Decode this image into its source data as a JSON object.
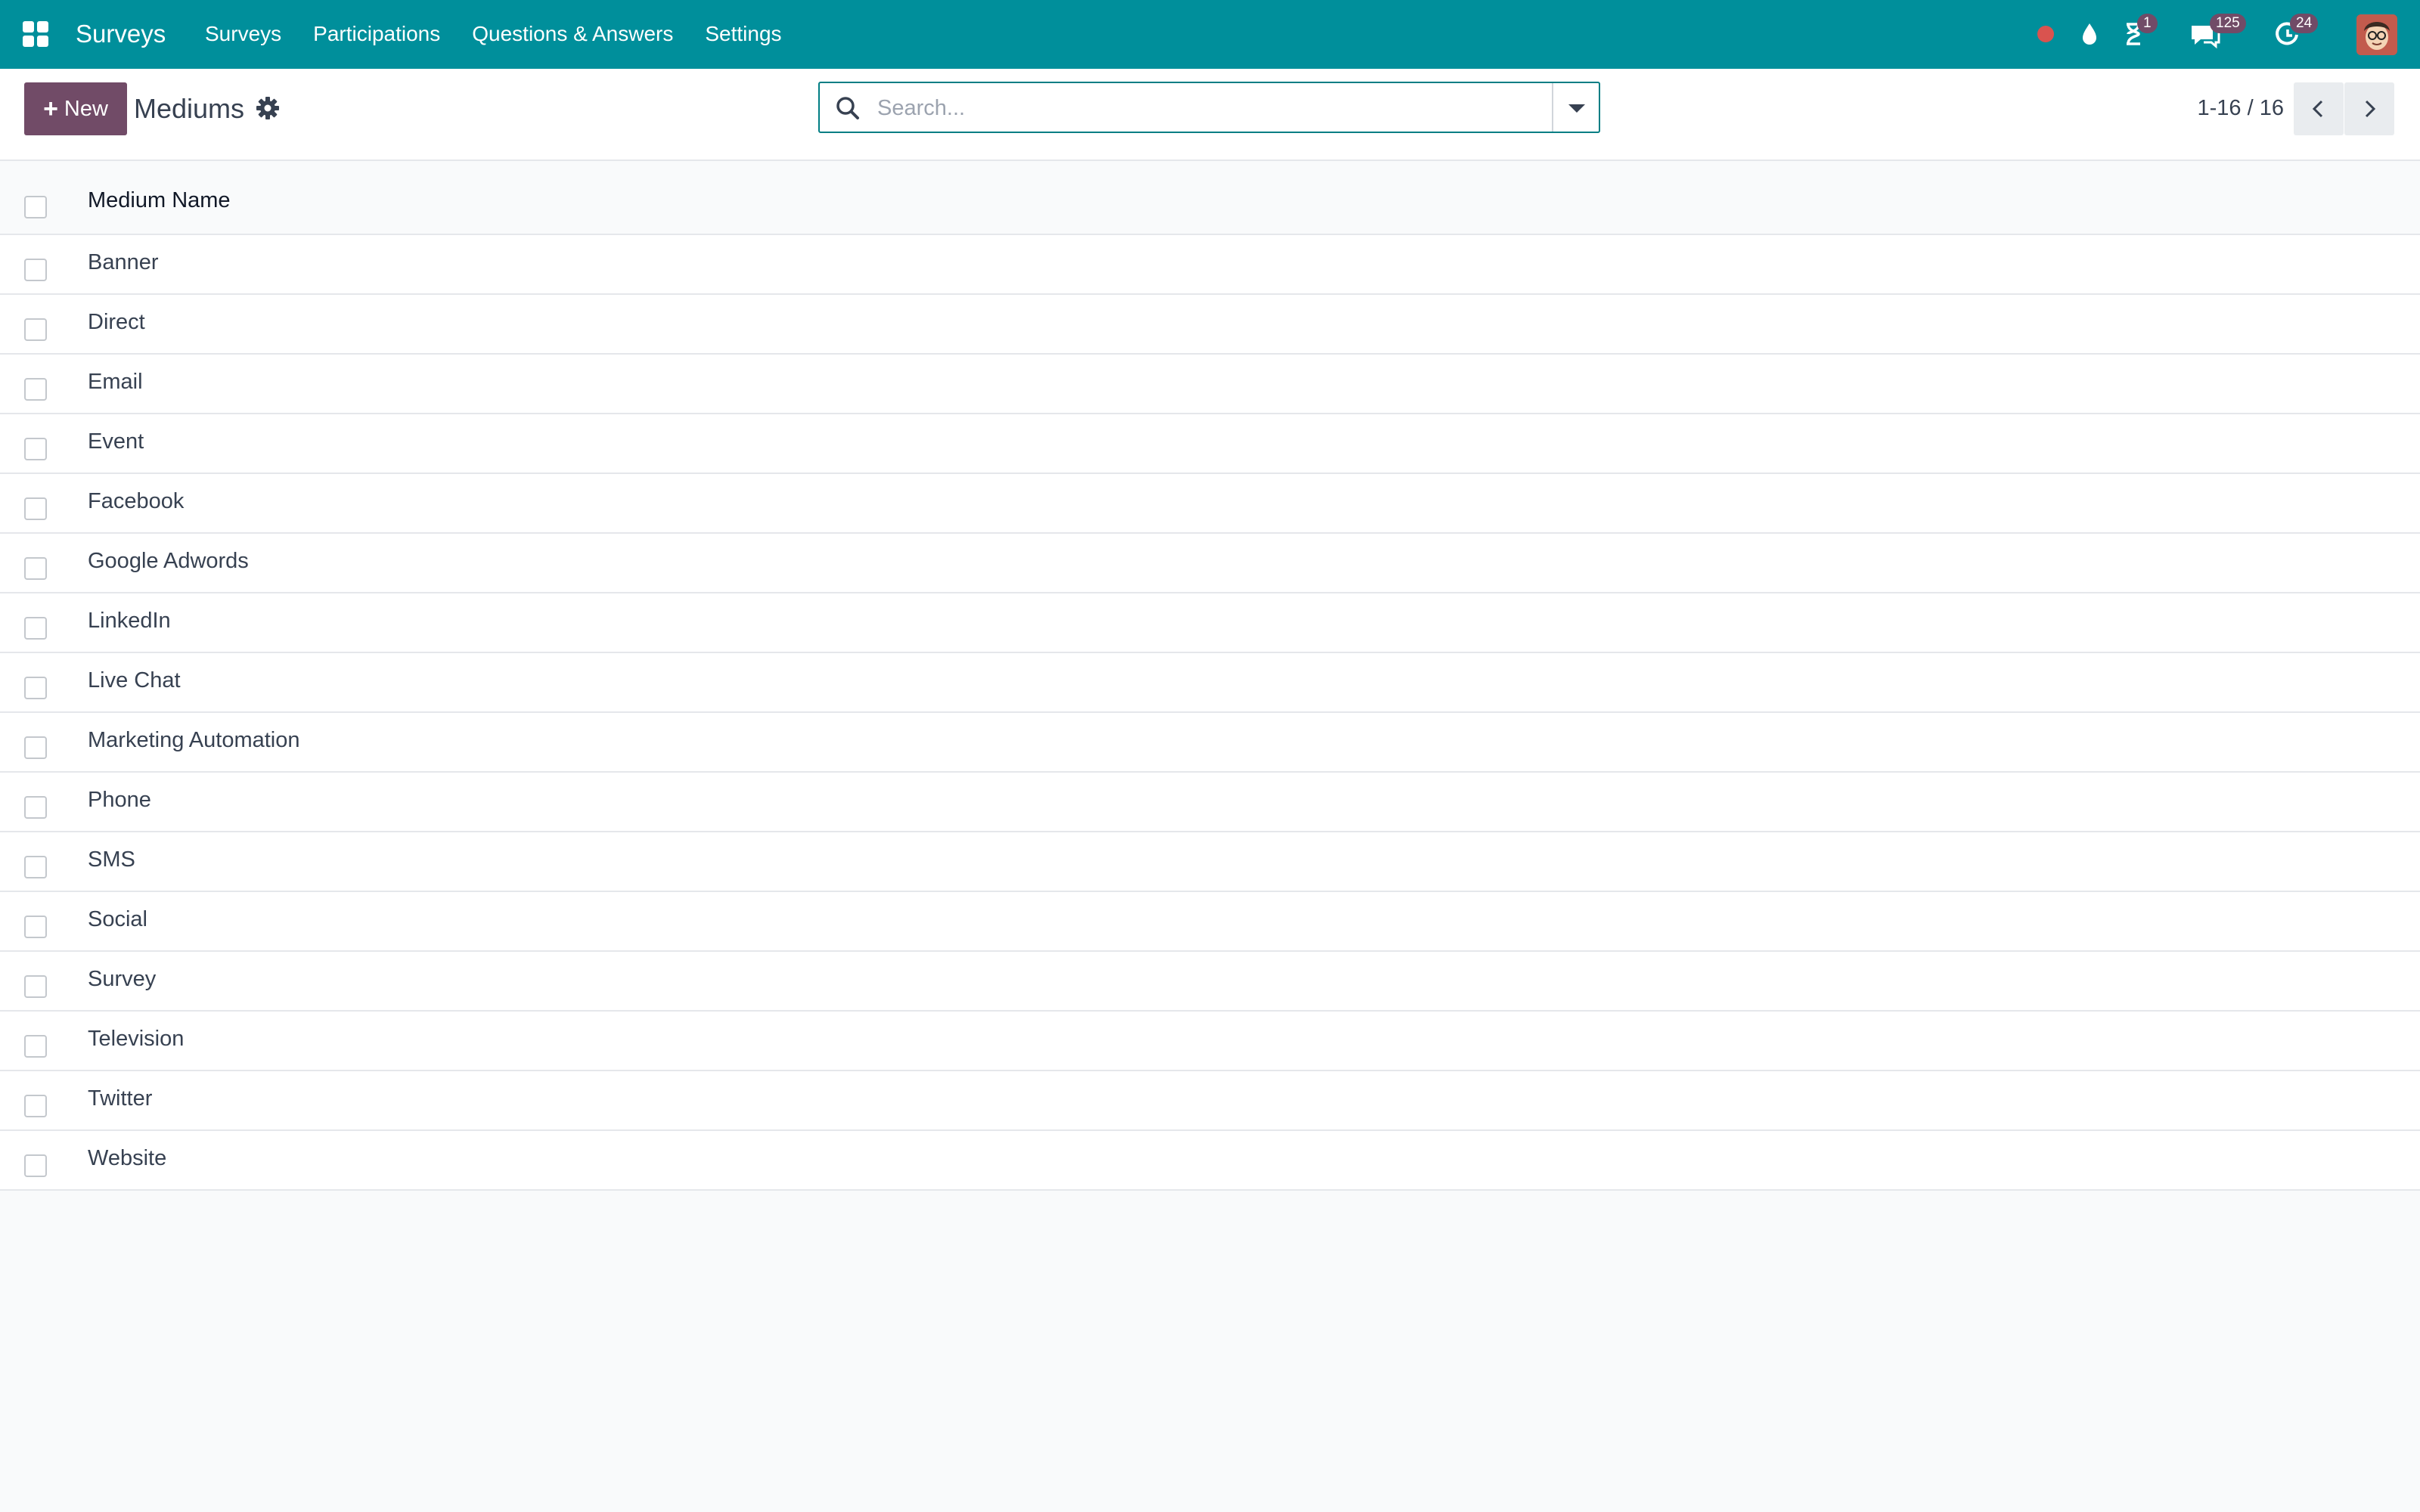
{
  "navbar": {
    "app_name": "Surveys",
    "menu": [
      "Surveys",
      "Participations",
      "Questions & Answers",
      "Settings"
    ],
    "systray": {
      "activity_badge": "1",
      "messages_badge": "125",
      "updates_badge": "24"
    },
    "colors": {
      "bar": "#008f9b",
      "badge": "#714b67",
      "recording_dot": "#d9534f"
    }
  },
  "control_panel": {
    "new_label": "New",
    "title": "Mediums",
    "search_placeholder": "Search...",
    "pager": "1-16 / 16"
  },
  "list": {
    "column_header": "Medium Name",
    "rows": [
      "Banner",
      "Direct",
      "Email",
      "Event",
      "Facebook",
      "Google Adwords",
      "LinkedIn",
      "Live Chat",
      "Marketing Automation",
      "Phone",
      "SMS",
      "Social",
      "Survey",
      "Television",
      "Twitter",
      "Website"
    ]
  }
}
